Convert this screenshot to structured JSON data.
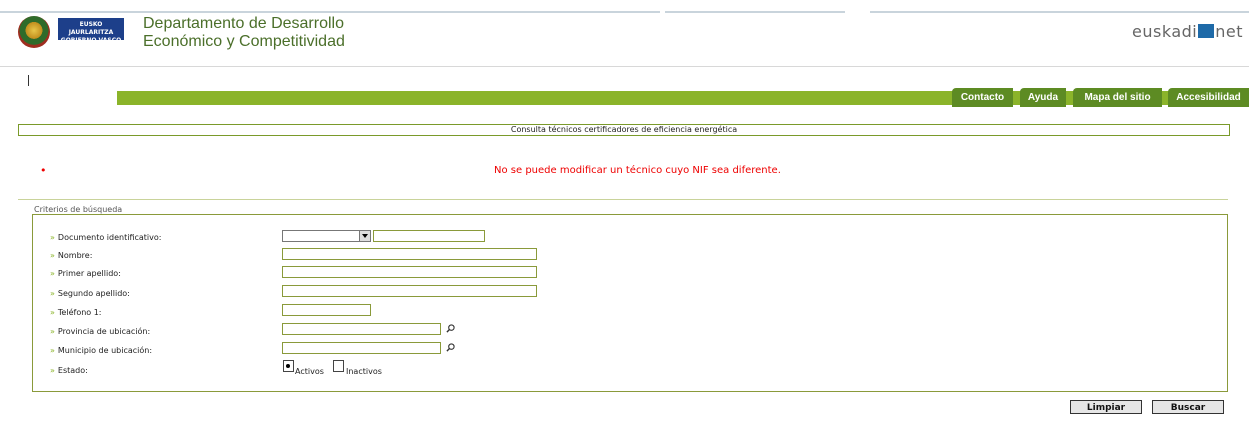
{
  "header": {
    "department_line1": "Departamento de Desarrollo",
    "department_line2": "Económico y Competitividad",
    "gov_badge_line1": "EUSKO JAURLARITZA",
    "gov_badge_line2": "GOBIERNO VASCO",
    "brand_left": "euskadi",
    "brand_right": "net",
    "brand_color": "#1e6aa8"
  },
  "nav": {
    "bar_color": "#8bb42a",
    "tab_color": "#5d8b23",
    "tabs": [
      "Contacto",
      "Ayuda",
      "Mapa del sitio",
      "Accesibilidad"
    ]
  },
  "page": {
    "title": "Consulta técnicos certificadores de eficiencia energética",
    "error_bullet": "•",
    "error_message": "No se puede modificar un técnico cuyo NIF sea diferente.",
    "error_color": "#e00000"
  },
  "form": {
    "legend": "Criterios de búsqueda",
    "arrow": "»",
    "labels": {
      "documento": "Documento identificativo:",
      "nombre": "Nombre:",
      "primer_apellido": "Primer apellido:",
      "segundo_apellido": "Segundo apellido:",
      "telefono": "Teléfono 1:",
      "provincia": "Provincia de ubicación:",
      "municipio": "Municipio de ubicación:",
      "estado": "Estado:"
    },
    "values": {
      "documento_tipo": "",
      "documento_numero": "",
      "nombre": "",
      "primer_apellido": "",
      "segundo_apellido": "",
      "telefono": "",
      "provincia": "",
      "municipio": ""
    },
    "estado_options": [
      "Activos",
      "Inactivos"
    ],
    "estado_selected": "Activos",
    "buttons": {
      "limpiar": "Limpiar",
      "buscar": "Buscar"
    }
  }
}
